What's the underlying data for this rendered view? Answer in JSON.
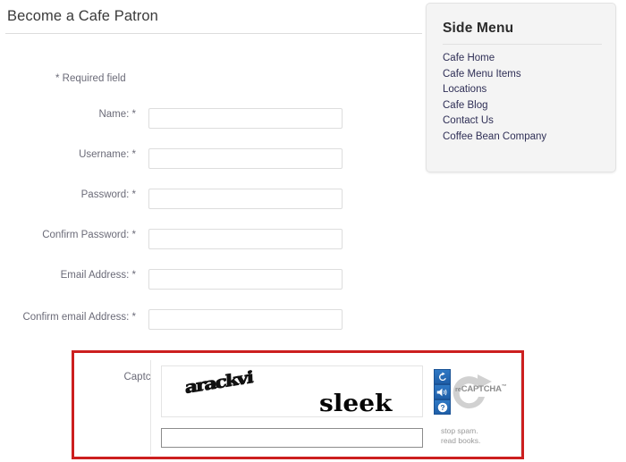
{
  "page": {
    "title": "Become a Cafe Patron"
  },
  "side_menu": {
    "title": "Side Menu",
    "items": [
      {
        "label": "Cafe Home"
      },
      {
        "label": "Cafe Menu Items"
      },
      {
        "label": "Locations"
      },
      {
        "label": "Cafe Blog"
      },
      {
        "label": "Contact Us"
      },
      {
        "label": "Coffee Bean Company"
      }
    ]
  },
  "form": {
    "required_note": "* Required field",
    "fields": [
      {
        "label": "Name: *",
        "value": "",
        "placeholder": ""
      },
      {
        "label": "Username: *",
        "value": "",
        "placeholder": ""
      },
      {
        "label": "Password: *",
        "value": "",
        "placeholder": ""
      },
      {
        "label": "Confirm Password: *",
        "value": "",
        "placeholder": ""
      },
      {
        "label": "Email Address: *",
        "value": "",
        "placeholder": ""
      },
      {
        "label": "Confirm email Address: *",
        "value": "",
        "placeholder": ""
      }
    ]
  },
  "captcha": {
    "label": "Captcha *",
    "challenge_word_1": "arackvi",
    "challenge_word_2": "sleek",
    "input_value": "",
    "input_placeholder": "",
    "brand_prefix": "re",
    "brand_name": "CAPTCHA",
    "brand_tm": "™",
    "tagline_line1": "stop spam.",
    "tagline_line2": "read books.",
    "buttons": [
      {
        "name": "refresh-icon",
        "title": "Get a new challenge"
      },
      {
        "name": "audio-icon",
        "title": "Get an audio challenge"
      },
      {
        "name": "help-icon",
        "title": "Help"
      }
    ],
    "border_color": "#cc1f1f"
  },
  "colors": {
    "link": "#2f2f56",
    "label": "#6b6b78",
    "panel_bg": "#f4f4f4",
    "captcha_border": "#cc1f1f",
    "button_blue": "#2f78c4"
  }
}
